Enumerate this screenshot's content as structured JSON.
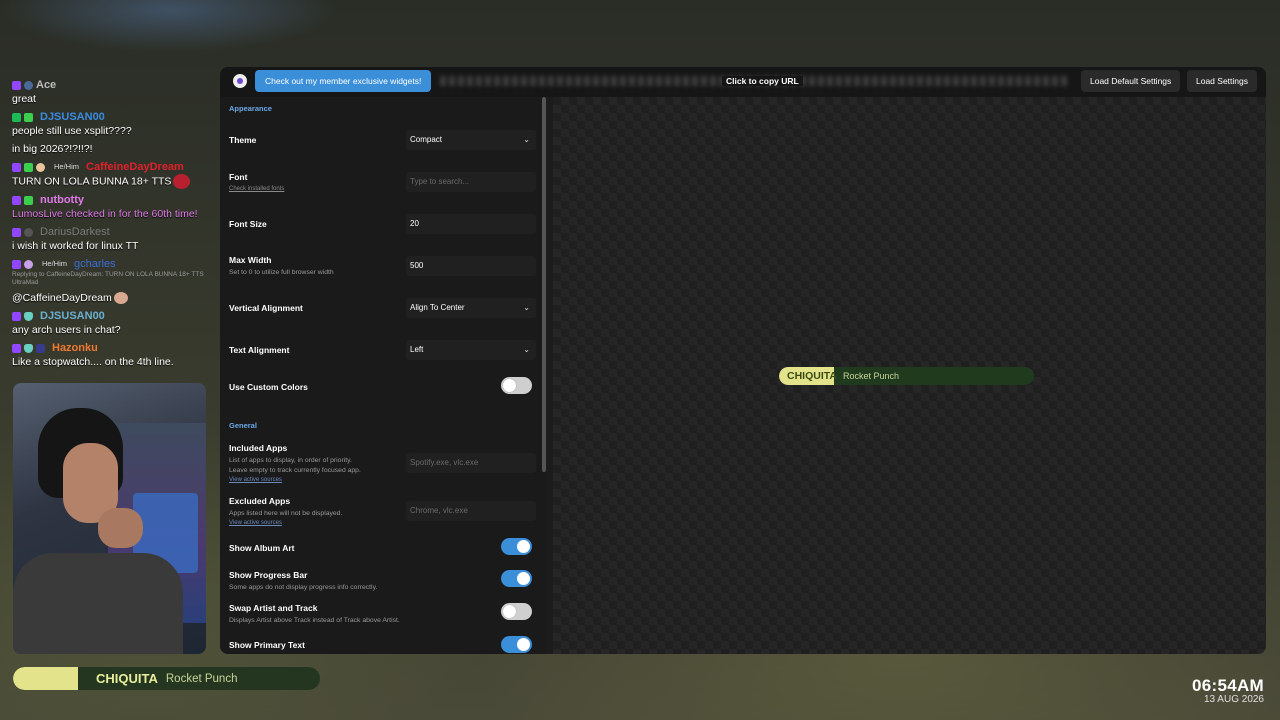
{
  "chat": {
    "messages": [
      {
        "user": "Ace",
        "color": "#bdbdbd",
        "pronoun": "",
        "text": "great"
      },
      {
        "user": "DJSUSAN00",
        "color": "#3a8be0",
        "pronoun": "",
        "text": "people still use xsplit????",
        "text2": "in big 2026?!?!!?!"
      },
      {
        "user": "CaffeineDayDream",
        "color": "#e0202a",
        "pronoun": "He/Him",
        "text": "TURN ON LOLA BUNNA 18+ TTS"
      },
      {
        "user": "nutbotty",
        "color": "#e07ae8",
        "pronoun": "",
        "text": "LumosLive checked in for the 60th time!",
        "textColor": "#e07ae8"
      },
      {
        "user": "DariusDarkest",
        "color": "#7a7a7a",
        "pronoun": "",
        "text": "i wish it worked for linux TT"
      },
      {
        "user": "gcharles",
        "color": "#3a6ed8",
        "pronoun": "He/Him",
        "reply": "Replying to CaffeineDayDream: TURN ON LOLA BUNNA 18+ TTS UltraMad",
        "text": "@CaffeineDayDream"
      },
      {
        "user": "DJSUSAN00",
        "color": "#6ab0d0",
        "pronoun": "",
        "text": "any arch users in chat?"
      },
      {
        "user": "Hazonku",
        "color": "#f07830",
        "pronoun": "",
        "text": "Like a stopwatch.... on the 4th line."
      }
    ]
  },
  "nowplaying": {
    "track": "CHIQUITA",
    "artist": "Rocket Punch",
    "progress": 0.21
  },
  "clock": {
    "time": "06:54AM",
    "date": "13 AUG 2026"
  },
  "toolbar": {
    "member_label": "Check out my member exclusive widgets!",
    "copy_url_label": "Click to copy URL",
    "load_default_label": "Load Default Settings",
    "load_label": "Load Settings"
  },
  "settings": {
    "appearance_header": "Appearance",
    "theme_label": "Theme",
    "theme_value": "Compact",
    "font_label": "Font",
    "font_link": "Check installed fonts",
    "font_placeholder": "Type to search...",
    "font_size_label": "Font Size",
    "font_size_value": "20",
    "max_width_label": "Max Width",
    "max_width_sub": "Set to 0 to utilize full browser width",
    "max_width_value": "500",
    "valign_label": "Vertical Alignment",
    "valign_value": "Align To Center",
    "talign_label": "Text Alignment",
    "talign_value": "Left",
    "custom_colors_label": "Use Custom Colors",
    "general_header": "General",
    "included_label": "Included Apps",
    "included_sub1": "List of apps to display, in order of priority.",
    "included_sub2": "Leave empty to track currently focused app.",
    "included_link": "View active sources",
    "included_placeholder": "Spotify.exe, vlc.exe",
    "excluded_label": "Excluded Apps",
    "excluded_sub": "Apps listed here will not be displayed.",
    "excluded_link": "View active sources",
    "excluded_placeholder": "Chrome, vlc.exe",
    "album_art_label": "Show Album Art",
    "progress_label": "Show Progress Bar",
    "progress_sub": "Some apps do not display progress info correctly.",
    "swap_label": "Swap Artist and Track",
    "swap_sub": "Displays Artist above Track instead of Track above Artist.",
    "primary_label": "Show Primary Text"
  },
  "preview": {
    "track": "CHIQUITA",
    "artist": "Rocket Punch"
  },
  "colors": {
    "accent": "#3a8fd8",
    "widget_bar": "#e3e38c",
    "widget_bg": "#24361f"
  }
}
